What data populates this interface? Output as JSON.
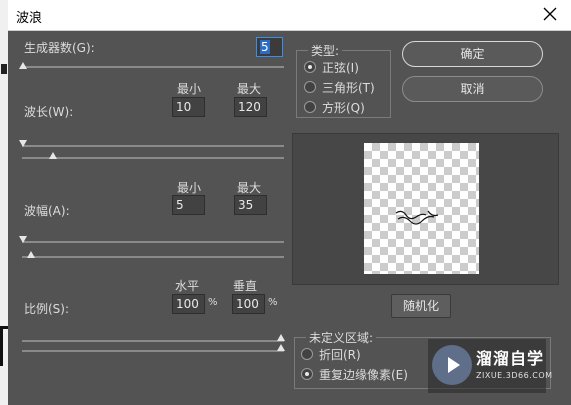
{
  "window": {
    "title": "波浪"
  },
  "generators": {
    "label": "生成器数(G):",
    "value": "5"
  },
  "wavelength": {
    "label": "波长(W):",
    "min_header": "最小",
    "max_header": "最大",
    "min_value": "10",
    "max_value": "120"
  },
  "amplitude": {
    "label": "波幅(A):",
    "min_header": "最小",
    "max_header": "最大",
    "min_value": "5",
    "max_value": "35"
  },
  "scale": {
    "label": "比例(S):",
    "h_header": "水平",
    "v_header": "垂直",
    "h_value": "100",
    "v_value": "100",
    "unit": "%"
  },
  "type_group": {
    "legend": "类型:",
    "options": [
      "正弦(I)",
      "三角形(T)",
      "方形(Q)"
    ],
    "selected": 0
  },
  "buttons": {
    "ok": "确定",
    "cancel": "取消",
    "randomize": "随机化"
  },
  "undefined_area": {
    "legend": "未定义区域:",
    "options": [
      "折回(R)",
      "重复边缘像素(E)"
    ],
    "selected": 1
  },
  "watermark": {
    "title": "溜溜自学",
    "url": "ZIXUE.3D66.COM"
  },
  "colors": {
    "dialog_bg": "#535353",
    "focus_border": "#3a8ee6",
    "text": "#dcdcdc"
  }
}
